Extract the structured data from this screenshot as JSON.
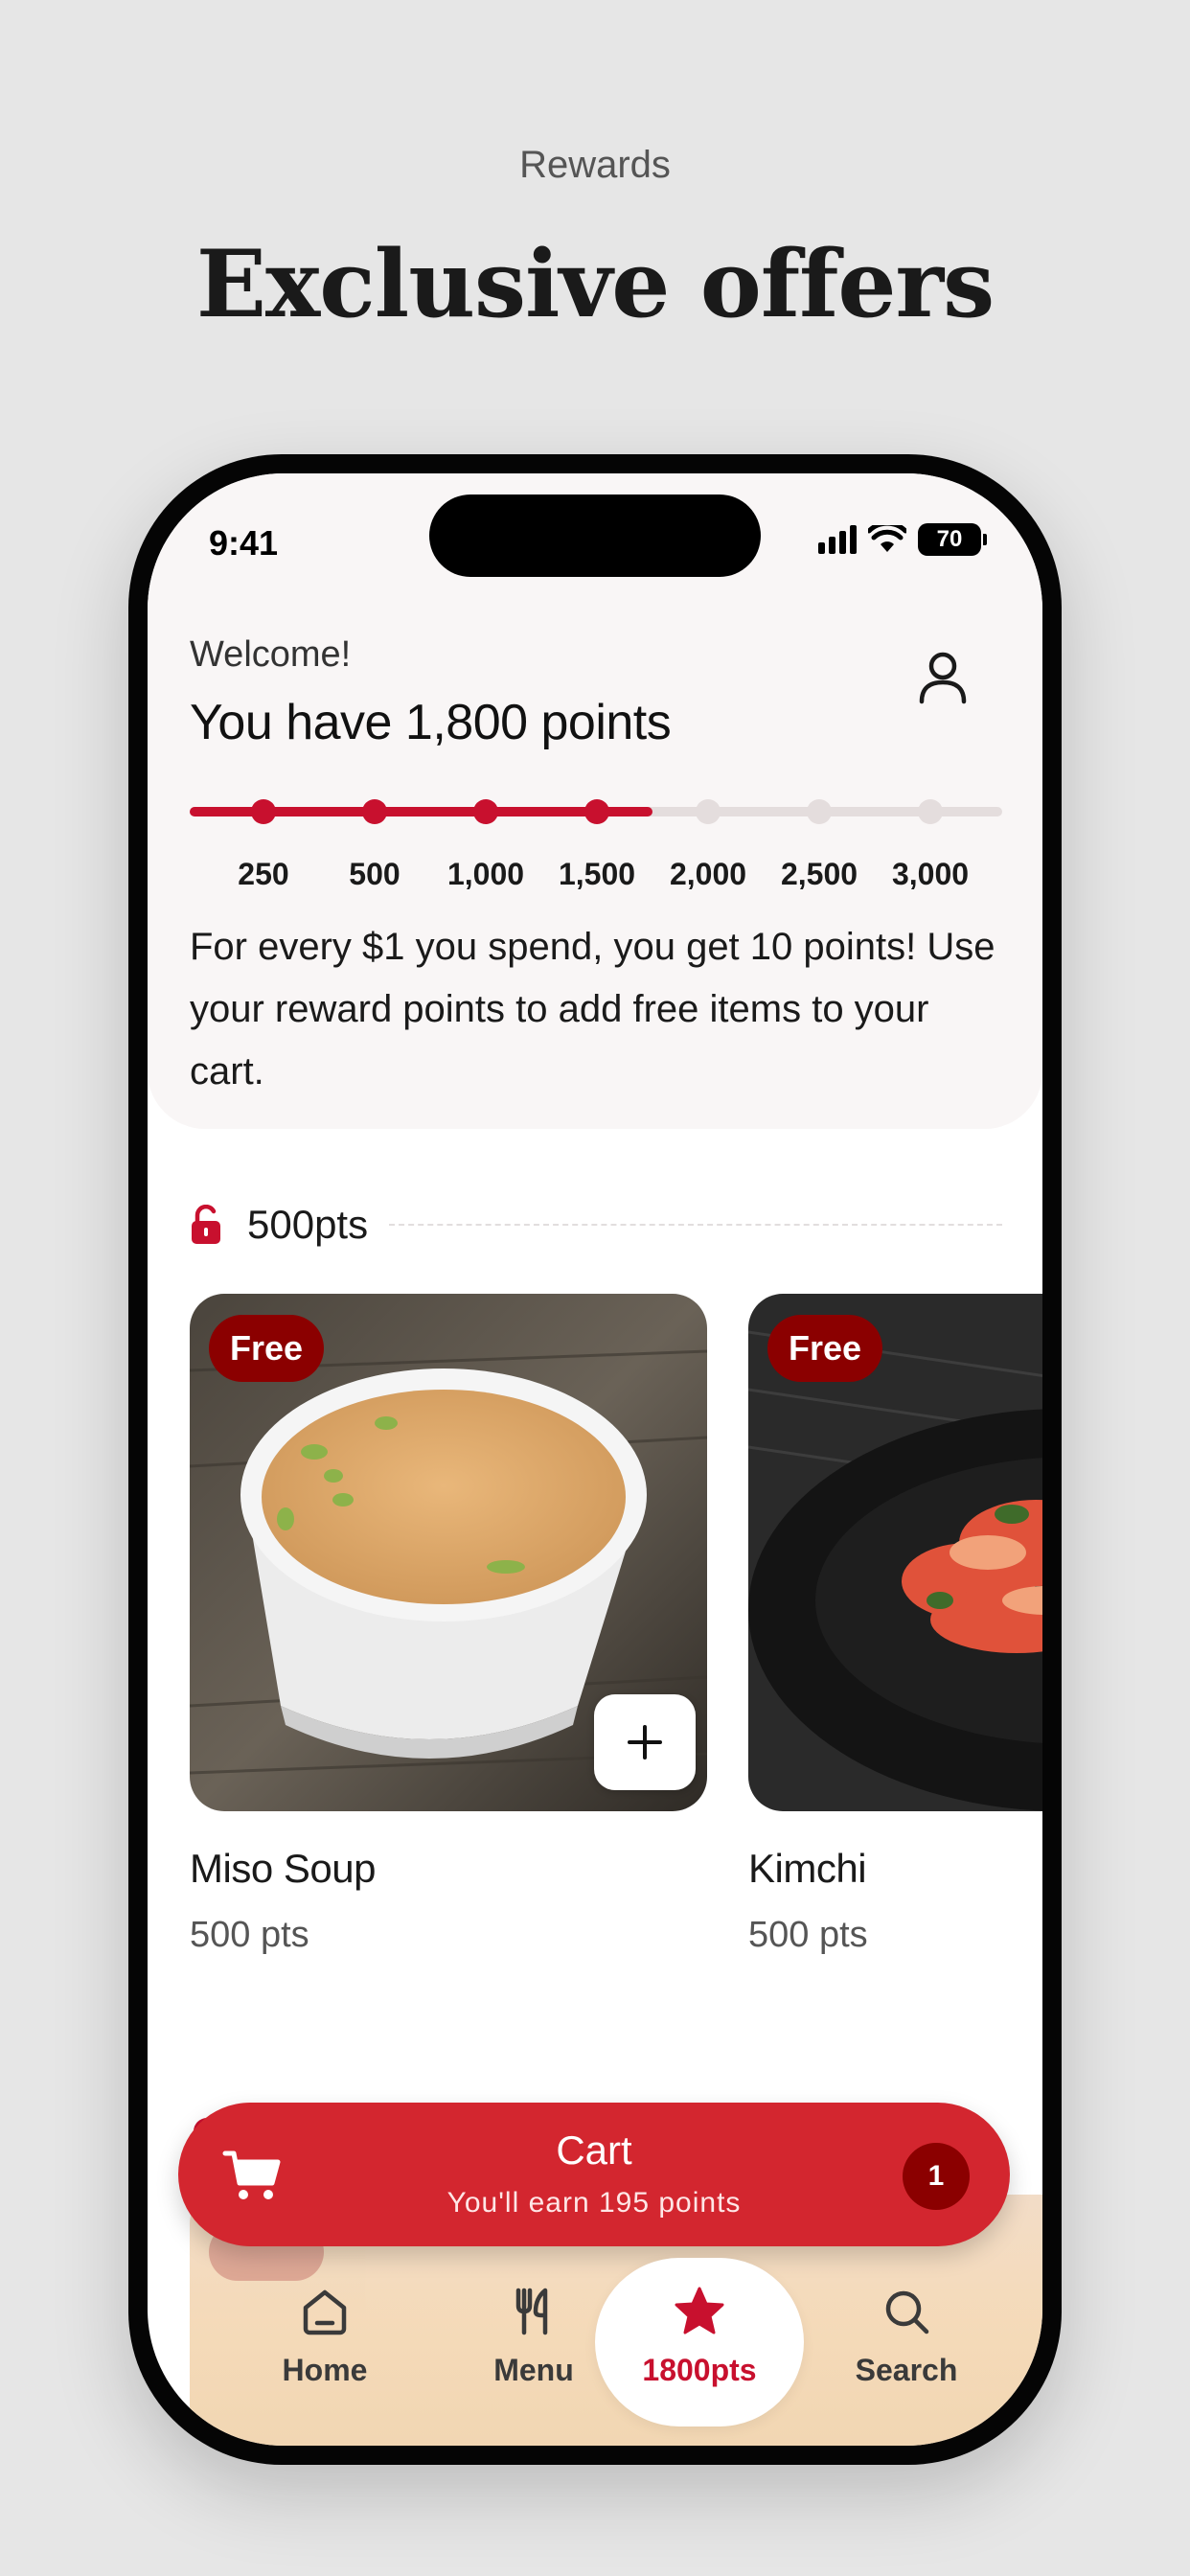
{
  "promo": {
    "subtitle": "Rewards",
    "title": "Exclusive offers"
  },
  "status_bar": {
    "time": "9:41",
    "battery": "70"
  },
  "hero": {
    "welcome": "Welcome!",
    "points_line": "You have 1,800 points",
    "progress": {
      "current_points": 1800,
      "max_points": 3000,
      "milestones": [
        "250",
        "500",
        "1,000",
        "1,500",
        "2,000",
        "2,500",
        "3,000"
      ],
      "reached": [
        true,
        true,
        true,
        true,
        false,
        false,
        false
      ]
    },
    "description": "For every $1 you spend, you get 10 points! Use your reward points to add free items to your cart."
  },
  "tier": {
    "label": "500pts"
  },
  "items": [
    {
      "badge": "Free",
      "name": "Miso Soup",
      "price": "500 pts"
    },
    {
      "badge": "Free",
      "name": "Kimchi",
      "price": "500 pts"
    }
  ],
  "cart": {
    "title": "Cart",
    "subtitle": "You'll earn 195 points",
    "count": "1"
  },
  "tabs": [
    {
      "label": "Home",
      "icon": "home-icon",
      "active": false
    },
    {
      "label": "Menu",
      "icon": "fork-knife-icon",
      "active": false
    },
    {
      "label": "1800pts",
      "icon": "star-icon",
      "active": true
    },
    {
      "label": "Search",
      "icon": "search-icon",
      "active": false
    }
  ],
  "colors": {
    "accent": "#c8102e",
    "cart": "#d3262f",
    "badge": "#8b0000",
    "hero_bg": "#f9f6f6"
  }
}
